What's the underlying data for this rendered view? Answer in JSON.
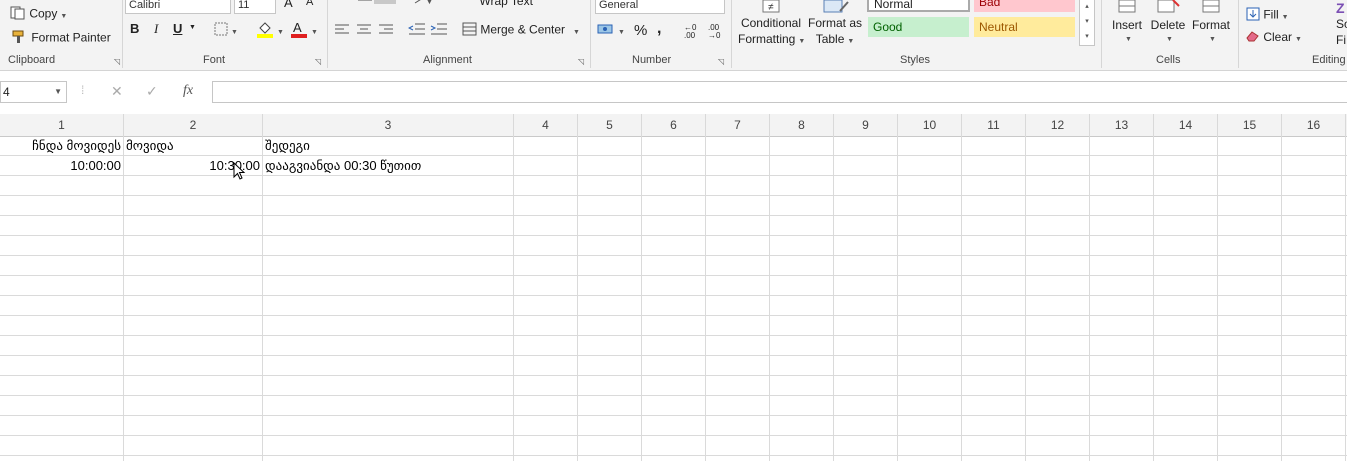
{
  "ribbon": {
    "clipboard": {
      "copy_label": "Copy",
      "format_painter_label": "Format Painter",
      "group_label": "Clipboard"
    },
    "font": {
      "font_name": "Calibri",
      "font_size": "11",
      "bold": "B",
      "italic": "I",
      "underline": "U",
      "group_label": "Font"
    },
    "alignment": {
      "wrap_text_label": "Wrap Text",
      "merge_center_label": "Merge & Center",
      "group_label": "Alignment"
    },
    "number": {
      "format_value": "General",
      "percent": "%",
      "comma": ",",
      "group_label": "Number"
    },
    "styles": {
      "conditional_formatting_line1": "Conditional",
      "conditional_formatting_line2": "Formatting",
      "format_as_table_line1": "Format as",
      "format_as_table_line2": "Table",
      "normal": "Normal",
      "bad": "Bad",
      "good": "Good",
      "neutral": "Neutral",
      "group_label": "Styles"
    },
    "cells": {
      "insert_label": "Insert",
      "delete_label": "Delete",
      "format_label": "Format",
      "group_label": "Cells"
    },
    "editing": {
      "fill_label": "Fill",
      "clear_label": "Clear",
      "group_label": "Editing",
      "sort_partial": "So",
      "find_partial": "Fi"
    }
  },
  "formula_bar": {
    "name_box": "4",
    "cancel": "✕",
    "enter": "✓",
    "fx": "fx",
    "formula": ""
  },
  "columns": [
    "1",
    "2",
    "3",
    "4",
    "5",
    "6",
    "7",
    "8",
    "9",
    "10",
    "11",
    "12",
    "13",
    "14",
    "15",
    "16"
  ],
  "rows": [
    {
      "c1": "ჩნდა მოვიდეს",
      "c2": "მოვიდა",
      "c3": "შედეგი"
    },
    {
      "c1": "10:00:00",
      "c2": "10:30:00",
      "c3": "დააგვიანდა 00:30 წუთით"
    }
  ],
  "colors": {
    "good_bg": "#c6efce",
    "good_fg": "#006100",
    "bad_bg": "#ffc7ce",
    "bad_fg": "#9c0006",
    "neutral_bg": "#ffeb9c",
    "neutral_fg": "#9c5700",
    "font_color_bar": "#e02020",
    "fill_color_bar": "#ffff00"
  }
}
